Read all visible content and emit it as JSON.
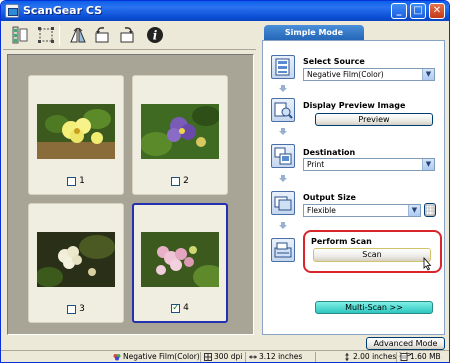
{
  "window": {
    "title": "ScanGear CS"
  },
  "title_buttons": {
    "minimize": "_",
    "maximize": "□",
    "close": "✕"
  },
  "toolbar": {
    "items": [
      "thumbnail-view",
      "crop",
      "rotate",
      "rotate-left",
      "rotate-right",
      "info"
    ]
  },
  "frames": [
    {
      "label": "1",
      "checked": false,
      "selected": false
    },
    {
      "label": "2",
      "checked": false,
      "selected": false
    },
    {
      "label": "3",
      "checked": false,
      "selected": false
    },
    {
      "label": "4",
      "checked": true,
      "selected": true
    }
  ],
  "panel": {
    "tab": "Simple Mode",
    "select_source": {
      "label": "Select Source",
      "value": "Negative Film(Color)"
    },
    "display_preview": {
      "label": "Display Preview Image",
      "button": "Preview"
    },
    "destination": {
      "label": "Destination",
      "value": "Print"
    },
    "output_size": {
      "label": "Output Size",
      "value": "Flexible"
    },
    "perform_scan": {
      "label": "Perform Scan",
      "button": "Scan"
    },
    "multi_scan": "Multi-Scan >>"
  },
  "advanced_button": "Advanced Mode >>",
  "statusbar": {
    "film": "Negative Film(Color)",
    "dpi": "300 dpi",
    "width": "3.12 inches",
    "height": "2.00 inches",
    "size": "1.60 MB"
  },
  "colors": {
    "titlebar": "#0a5fe8",
    "selected_frame": "#2330b0",
    "highlight": "#d8252b",
    "multi_scan": "#2ec6c0"
  }
}
